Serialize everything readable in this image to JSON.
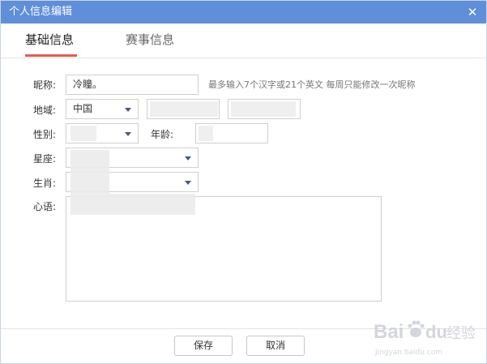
{
  "window": {
    "title": "个人信息编辑",
    "close_glyph": "✕",
    "accent": "#5f8fd8"
  },
  "tabs": [
    {
      "label": "基础信息",
      "active": true
    },
    {
      "label": "赛事信息",
      "active": false
    }
  ],
  "form": {
    "nickname": {
      "label": "昵称:",
      "value": "冷瞳。",
      "hint": "最多输入7个汉字或21个英文 每周只能修改一次昵称"
    },
    "region": {
      "label": "地域:",
      "country": "中国"
    },
    "gender": {
      "label": "性别:"
    },
    "age": {
      "label": "年龄:"
    },
    "constellation": {
      "label": "星座:"
    },
    "zodiac": {
      "label": "生肖:"
    },
    "motto": {
      "label": "心语:"
    }
  },
  "buttons": {
    "save": "保存",
    "cancel": "取消"
  },
  "watermark": {
    "brand": "Bai",
    "brand2": "du",
    "tag": "经验",
    "site": "jingyan.baidu.com"
  },
  "icons": {
    "close": "close-icon",
    "dropdown": "chevron-down-icon",
    "paw": "paw-icon"
  }
}
